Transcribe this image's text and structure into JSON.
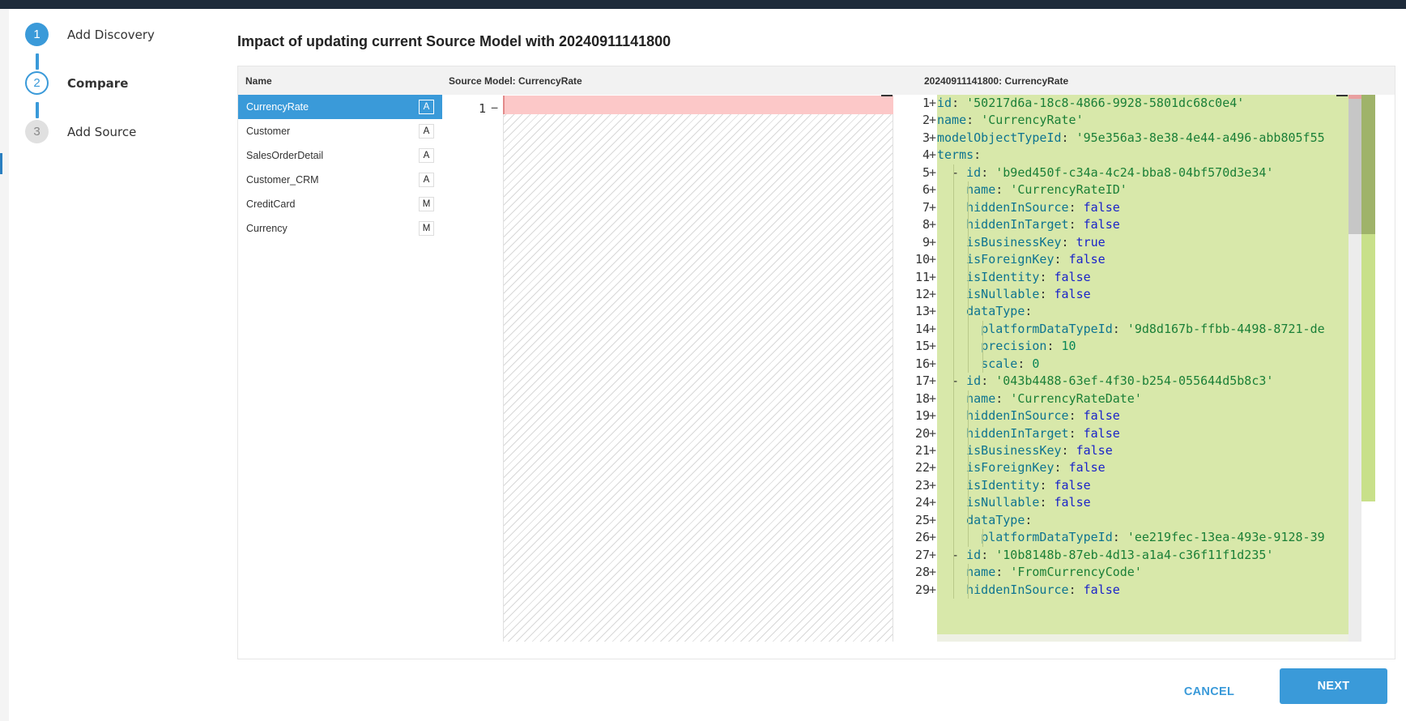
{
  "stepper": {
    "steps": [
      {
        "number": "1",
        "label": "Add Discovery",
        "state": "done"
      },
      {
        "number": "2",
        "label": "Compare",
        "state": "active"
      },
      {
        "number": "3",
        "label": "Add Source",
        "state": "todo"
      }
    ]
  },
  "dialog": {
    "title": "Impact of updating current Source Model with 20240911141800"
  },
  "table": {
    "col_name": "Name",
    "col_source": "Source Model: CurrencyRate",
    "col_target": "20240911141800: CurrencyRate"
  },
  "items": [
    {
      "name": "CurrencyRate",
      "badge": "A"
    },
    {
      "name": "Customer",
      "badge": "A"
    },
    {
      "name": "SalesOrderDetail",
      "badge": "A"
    },
    {
      "name": "Customer_CRM",
      "badge": "A"
    },
    {
      "name": "CreditCard",
      "badge": "M"
    },
    {
      "name": "Currency",
      "badge": "M"
    }
  ],
  "source_editor": {
    "line_number": "1",
    "marker": "−"
  },
  "target_editor": {
    "lines": [
      {
        "n": "1",
        "indent": 0,
        "key": "id",
        "val": "'50217d6a-18c8-4866-9928-5801dc68c0e4'",
        "vtype": "s"
      },
      {
        "n": "2",
        "indent": 0,
        "key": "name",
        "val": "'CurrencyRate'",
        "vtype": "s"
      },
      {
        "n": "3",
        "indent": 0,
        "key": "modelObjectTypeId",
        "val": "'95e356a3-8e38-4e44-a496-abb805f55",
        "vtype": "s"
      },
      {
        "n": "4",
        "indent": 0,
        "key": "terms",
        "val": "",
        "vtype": "s"
      },
      {
        "n": "5",
        "indent": 1,
        "dash": true,
        "key": "id",
        "val": "'b9ed450f-c34a-4c24-bba8-04bf570d3e34'",
        "vtype": "s"
      },
      {
        "n": "6",
        "indent": 2,
        "key": "name",
        "val": "'CurrencyRateID'",
        "vtype": "s"
      },
      {
        "n": "7",
        "indent": 2,
        "key": "hiddenInSource",
        "val": "false",
        "vtype": "b"
      },
      {
        "n": "8",
        "indent": 2,
        "key": "hiddenInTarget",
        "val": "false",
        "vtype": "b"
      },
      {
        "n": "9",
        "indent": 2,
        "key": "isBusinessKey",
        "val": "true",
        "vtype": "b"
      },
      {
        "n": "10",
        "indent": 2,
        "key": "isForeignKey",
        "val": "false",
        "vtype": "b"
      },
      {
        "n": "11",
        "indent": 2,
        "key": "isIdentity",
        "val": "false",
        "vtype": "b"
      },
      {
        "n": "12",
        "indent": 2,
        "key": "isNullable",
        "val": "false",
        "vtype": "b"
      },
      {
        "n": "13",
        "indent": 2,
        "key": "dataType",
        "val": "",
        "vtype": "s"
      },
      {
        "n": "14",
        "indent": 3,
        "key": "platformDataTypeId",
        "val": "'9d8d167b-ffbb-4498-8721-de",
        "vtype": "s"
      },
      {
        "n": "15",
        "indent": 3,
        "key": "precision",
        "val": "10",
        "vtype": "n"
      },
      {
        "n": "16",
        "indent": 3,
        "key": "scale",
        "val": "0",
        "vtype": "n"
      },
      {
        "n": "17",
        "indent": 1,
        "dash": true,
        "key": "id",
        "val": "'043b4488-63ef-4f30-b254-055644d5b8c3'",
        "vtype": "s"
      },
      {
        "n": "18",
        "indent": 2,
        "key": "name",
        "val": "'CurrencyRateDate'",
        "vtype": "s"
      },
      {
        "n": "19",
        "indent": 2,
        "key": "hiddenInSource",
        "val": "false",
        "vtype": "b"
      },
      {
        "n": "20",
        "indent": 2,
        "key": "hiddenInTarget",
        "val": "false",
        "vtype": "b"
      },
      {
        "n": "21",
        "indent": 2,
        "key": "isBusinessKey",
        "val": "false",
        "vtype": "b"
      },
      {
        "n": "22",
        "indent": 2,
        "key": "isForeignKey",
        "val": "false",
        "vtype": "b"
      },
      {
        "n": "23",
        "indent": 2,
        "key": "isIdentity",
        "val": "false",
        "vtype": "b"
      },
      {
        "n": "24",
        "indent": 2,
        "key": "isNullable",
        "val": "false",
        "vtype": "b"
      },
      {
        "n": "25",
        "indent": 2,
        "key": "dataType",
        "val": "",
        "vtype": "s"
      },
      {
        "n": "26",
        "indent": 3,
        "key": "platformDataTypeId",
        "val": "'ee219fec-13ea-493e-9128-39",
        "vtype": "s"
      },
      {
        "n": "27",
        "indent": 1,
        "dash": true,
        "key": "id",
        "val": "'10b8148b-87eb-4d13-a1a4-c36f11f1d235'",
        "vtype": "s"
      },
      {
        "n": "28",
        "indent": 2,
        "key": "name",
        "val": "'FromCurrencyCode'",
        "vtype": "s"
      },
      {
        "n": "29",
        "indent": 2,
        "key": "hiddenInSource",
        "val": "false",
        "vtype": "b"
      }
    ]
  },
  "footer": {
    "cancel_label": "CANCEL",
    "next_label": "NEXT"
  },
  "colors": {
    "accent": "#3a9ad9",
    "added": "#d8e8aa",
    "removed": "#fcc8c8"
  }
}
